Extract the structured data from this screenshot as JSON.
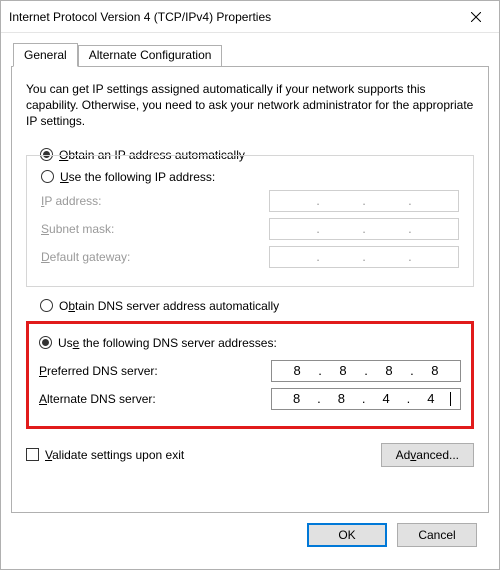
{
  "window": {
    "title": "Internet Protocol Version 4 (TCP/IPv4) Properties"
  },
  "tabs": {
    "general": "General",
    "alt": "Alternate Configuration",
    "active": "general"
  },
  "description": "You can get IP settings assigned automatically if your network supports this capability. Otherwise, you need to ask your network administrator for the appropriate IP settings.",
  "ip": {
    "obtain_auto": "Obtain an IP address automatically",
    "use_following": "Use the following IP address:",
    "selected": "auto",
    "labels": {
      "ip_address": "IP address:",
      "subnet": "Subnet mask:",
      "gateway": "Default gateway:"
    },
    "values": {
      "ip_address": [
        "",
        "",
        "",
        ""
      ],
      "subnet": [
        "",
        "",
        "",
        ""
      ],
      "gateway": [
        "",
        "",
        "",
        ""
      ]
    }
  },
  "dns": {
    "obtain_auto": "Obtain DNS server address automatically",
    "use_following": "Use the following DNS server addresses:",
    "selected": "manual",
    "labels": {
      "preferred": "Preferred DNS server:",
      "alternate": "Alternate DNS server:"
    },
    "values": {
      "preferred": [
        "8",
        "8",
        "8",
        "8"
      ],
      "alternate": [
        "8",
        "8",
        "4",
        "4"
      ]
    }
  },
  "validate_label": "Validate settings upon exit",
  "validate_checked": false,
  "advanced_label": "Advanced...",
  "buttons": {
    "ok": "OK",
    "cancel": "Cancel"
  },
  "access": {
    "O": "O",
    "btain_ip": "btain an IP address automatically",
    "U": "U",
    "se_ip": "se the following IP address:",
    "I": "I",
    "p_addr_rest": "P address:",
    "S": "S",
    "ubnet_rest": "ubnet mask:",
    "D": "D",
    "efault_gw_rest": "efault gateway:",
    "b": "b",
    "obtain_dns_pre": "O",
    "obtain_dns_rest": "tain DNS server address automatically",
    "e": "e",
    "use_dns_pre": "Us",
    "use_dns_rest": " the following DNS server addresses:",
    "P": "P",
    "referred_rest": "referred DNS server:",
    "A": "A",
    "lternate_rest": "lternate DNS server:",
    "V": "V",
    "alidate_rest": "alidate settings upon exit",
    "Adv_pre": "Ad",
    "v": "v",
    "Adv_rest": "anced..."
  }
}
